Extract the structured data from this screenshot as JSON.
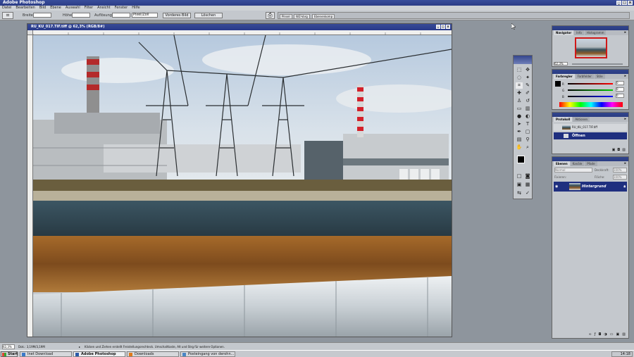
{
  "window": {
    "title": "Adobe Photoshop",
    "controls": [
      "_",
      "□",
      "×"
    ]
  },
  "menu": [
    "Datei",
    "Bearbeiten",
    "Bild",
    "Ebene",
    "Auswahl",
    "Filter",
    "Ansicht",
    "Fenster",
    "Hilfe"
  ],
  "options": {
    "width_label": "Breite:",
    "height_label": "Höhe:",
    "resolution_label": "Auflösung:",
    "unit_value": "Pixel/Zoll",
    "front_image_button": "Vorderes Bild",
    "clear_button": "Löschen"
  },
  "palette_well": {
    "tabs": [
      "Pinsel",
      "WZ-Vorg",
      "Ebenenkomp"
    ]
  },
  "document": {
    "title": "RU_KU_017.TIF.tiff @ 62,3% (RGB/8#)"
  },
  "navigator": {
    "tabs": [
      "Navigator",
      "Info",
      "Histogramm"
    ],
    "zoom": "62,3%"
  },
  "color": {
    "tabs": [
      "Farbregler",
      "Farbfelder",
      "Stile"
    ],
    "channels": [
      "R",
      "G",
      "B"
    ],
    "values": [
      "0",
      "0",
      "0"
    ]
  },
  "history": {
    "tabs": [
      "Protokoll",
      "Aktionen"
    ],
    "snapshot": "RU_KU_017.TIF.tiff",
    "items": [
      "Öffnen"
    ]
  },
  "layers": {
    "tabs": [
      "Ebenen",
      "Kanäle",
      "Pfade"
    ],
    "blend_mode": "Normal",
    "opacity_label": "Deckkraft:",
    "opacity": "100%",
    "fix_label": "Fixieren:",
    "fill_label": "Fläche:",
    "fill": "100%",
    "items": [
      "Hintergrund"
    ]
  },
  "status": {
    "zoom": "62,3%",
    "doc_size": "Dok.: 3,19M/3,19M",
    "hint": "Klicken und Ziehen erstellt Freistellungsrechteck. Umschalttaste, Alt und Strg für weitere Optionen."
  },
  "taskbar": {
    "start": "Start",
    "tasks": [
      "Inet Download",
      "Adobe Photoshop",
      "Downloads",
      "Posteingang von derohn..."
    ],
    "clock": "14:18"
  },
  "colors": {
    "titlebar": "#2c3d86",
    "selection": "#1f2f7f",
    "accent_red": "#d4202a"
  }
}
